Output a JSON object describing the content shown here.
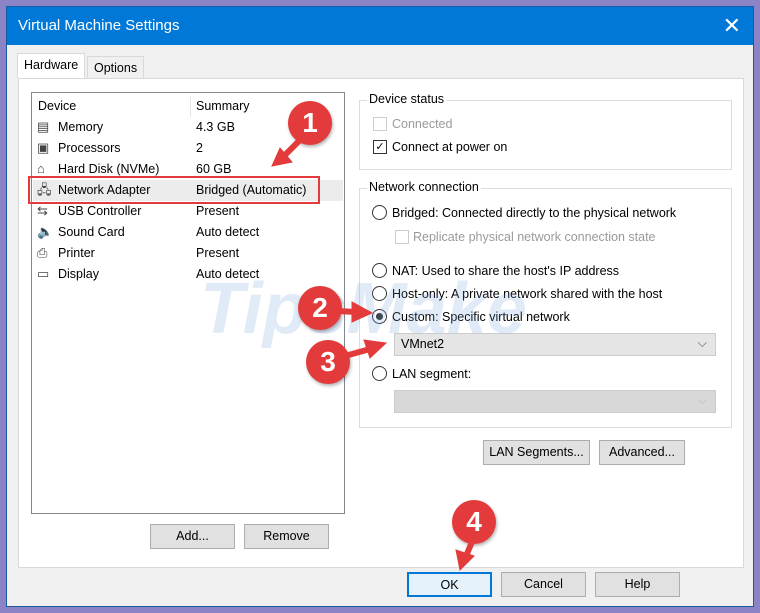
{
  "window": {
    "title": "Virtual Machine Settings"
  },
  "tabs": [
    {
      "label": "Hardware"
    },
    {
      "label": "Options"
    }
  ],
  "devices": {
    "header": {
      "device": "Device",
      "summary": "Summary"
    },
    "rows": [
      {
        "name": "Memory",
        "summary": "4.3 GB",
        "icon": "memory-icon"
      },
      {
        "name": "Processors",
        "summary": "2",
        "icon": "processor-icon"
      },
      {
        "name": "Hard Disk (NVMe)",
        "summary": "60 GB",
        "icon": "hard-disk-icon"
      },
      {
        "name": "Network Adapter",
        "summary": "Bridged (Automatic)",
        "icon": "network-adapter-icon"
      },
      {
        "name": "USB Controller",
        "summary": "Present",
        "icon": "usb-icon"
      },
      {
        "name": "Sound Card",
        "summary": "Auto detect",
        "icon": "speaker-icon"
      },
      {
        "name": "Printer",
        "summary": "Present",
        "icon": "printer-icon"
      },
      {
        "name": "Display",
        "summary": "Auto detect",
        "icon": "display-icon"
      }
    ]
  },
  "buttons": {
    "add": "Add...",
    "remove": "Remove",
    "lan_segments": "LAN Segments...",
    "advanced": "Advanced...",
    "ok": "OK",
    "cancel": "Cancel",
    "help": "Help"
  },
  "device_status": {
    "title": "Device status",
    "connected": "Connected",
    "connect_power_on": "Connect at power on"
  },
  "network": {
    "title": "Network connection",
    "bridged": "Bridged: Connected directly to the physical network",
    "replicate": "Replicate physical network connection state",
    "nat": "NAT: Used to share the host's IP address",
    "host_only": "Host-only: A private network shared with the host",
    "custom": "Custom: Specific virtual network",
    "custom_value": "VMnet2",
    "lan_segment": "LAN segment:"
  },
  "annotations": [
    "1",
    "2",
    "3",
    "4"
  ],
  "watermark": "TipsMake.com",
  "colors": {
    "title_bar": "#0078d7",
    "annotation": "#e33b3b"
  }
}
